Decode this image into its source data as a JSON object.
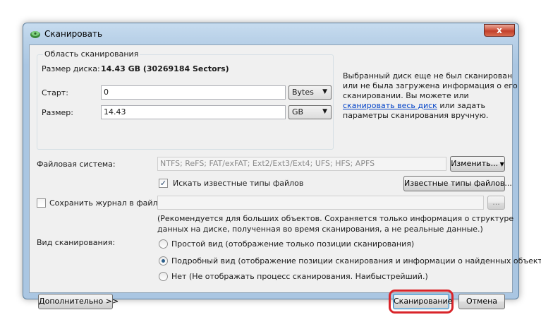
{
  "window": {
    "title": "Сканировать",
    "close_label": "x"
  },
  "scan_area": {
    "group_title": "Область сканирования",
    "disk_size_label": "Размер диска:",
    "disk_size_value": "14.43 GB (30269184 Sectors)",
    "start_label": "Старт:",
    "start_value": "0",
    "start_unit": "Bytes",
    "size_label": "Размер:",
    "size_value": "14.43",
    "size_unit": "GB",
    "info_line1": "Выбранный диск еще не был сканирован",
    "info_line2": "или не была загружена информация о его",
    "info_line3": "сканировании. Вы можете или",
    "info_link": "сканировать весь диск",
    "info_line4_rest": " или задать",
    "info_line5": "параметры сканирования вручную."
  },
  "filesystem": {
    "label": "Файловая система:",
    "value": "NTFS; ReFS; FAT/exFAT; Ext2/Ext3/Ext4; UFS; HFS; APFS",
    "change_button": "Изменить..."
  },
  "known_types": {
    "checkbox_label": "Искать известные типы файлов",
    "checked": true,
    "button": "Известные типы файлов..."
  },
  "save_log": {
    "checkbox_label": "Сохранить журнал в файл:",
    "checked": false,
    "path_value": "",
    "browse_button": "...",
    "note_line1": "(Рекомендуется для больших объектов. Сохраняется только информация о структуре",
    "note_line2": "данных на диске, полученная во время сканирования, а не реальные данные.)"
  },
  "scan_view": {
    "label": "Вид сканирования:",
    "options": [
      {
        "label": "Простой вид (отображение только позиции сканирования)",
        "checked": false
      },
      {
        "label": "Подробный вид (отображение позиции сканирования и информации о найденных объектах)",
        "checked": true
      },
      {
        "label": "Нет (Не отображать процесс сканирования. Наибыстрейший.)",
        "checked": false
      }
    ]
  },
  "footer": {
    "advanced_button": "Дополнительно >>",
    "scan_button": "Сканирование",
    "cancel_button": "Отмена"
  },
  "colors": {
    "link": "#0645c8",
    "highlight": "#d9252a",
    "title_bar": "#b9d1e8"
  }
}
